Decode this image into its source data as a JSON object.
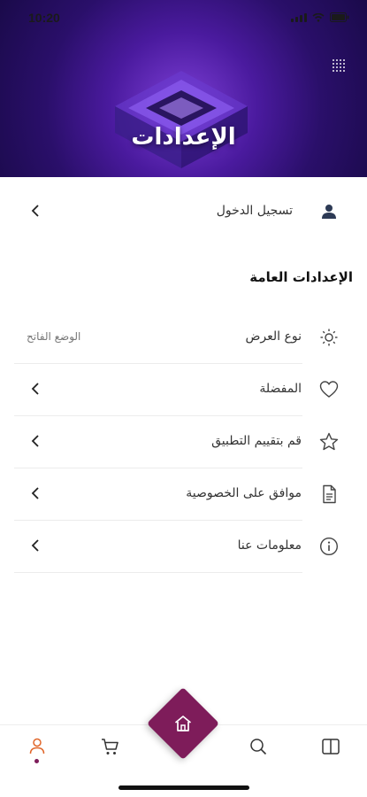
{
  "status_bar": {
    "time": "10:20"
  },
  "header": {
    "title": "الإعدادات"
  },
  "login": {
    "label": "تسجيل الدخول",
    "icon": "person-icon"
  },
  "general_settings": {
    "title": "الإعدادات العامة",
    "items": [
      {
        "label": "نوع العرض",
        "value": "الوضع الفاتح",
        "icon": "sun-icon"
      },
      {
        "label": "المفضلة",
        "icon": "heart-icon"
      },
      {
        "label": "قم بتقييم التطبيق",
        "icon": "star-icon"
      },
      {
        "label": "موافق على الخصوصية",
        "icon": "document-icon"
      },
      {
        "label": "معلومات عنا",
        "icon": "info-icon"
      }
    ]
  },
  "bottom_nav": {
    "items": [
      "profile-icon",
      "cart-icon",
      "home-icon",
      "search-icon",
      "book-icon"
    ],
    "active": "profile-icon",
    "accent": "#7e1c5a",
    "active_color": "#e0662a"
  }
}
